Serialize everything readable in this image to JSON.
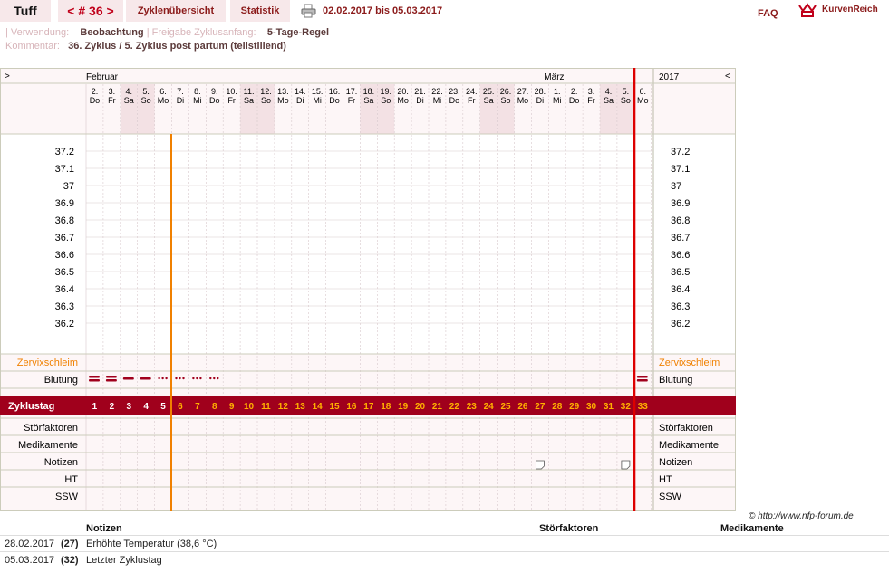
{
  "header": {
    "brand": "Tuff",
    "cycle_button": "< # 36 >",
    "overview_tab": "Zyklenübersicht",
    "stats_tab": "Statistik",
    "date_range": "02.02.2017 bis 05.03.2017",
    "faq": "FAQ",
    "logo_text": "KurvenReich",
    "printer_icon": "printer-icon",
    "logo_icon": "kurvenreich-logo-icon"
  },
  "meta": {
    "use_label": "Verwendung:",
    "use_value": "Beobachtung",
    "sep": "|",
    "release_label": "Freigabe Zyklusanfang:",
    "release_value": "5-Tage-Regel",
    "comment_label": "Kommentar:",
    "comment_value": "36. Zyklus / 5. Zyklus post partum (teilstillend)"
  },
  "chart": {
    "nav_left": ">",
    "nav_right": "<",
    "month1": "Februar",
    "month2": "März",
    "year": "2017",
    "days": [
      {
        "d": "2.",
        "w": "Do",
        "we": false
      },
      {
        "d": "3.",
        "w": "Fr",
        "we": false
      },
      {
        "d": "4.",
        "w": "Sa",
        "we": true
      },
      {
        "d": "5.",
        "w": "So",
        "we": true
      },
      {
        "d": "6.",
        "w": "Mo",
        "we": false
      },
      {
        "d": "7.",
        "w": "Di",
        "we": false
      },
      {
        "d": "8.",
        "w": "Mi",
        "we": false
      },
      {
        "d": "9.",
        "w": "Do",
        "we": false
      },
      {
        "d": "10.",
        "w": "Fr",
        "we": false
      },
      {
        "d": "11.",
        "w": "Sa",
        "we": true
      },
      {
        "d": "12.",
        "w": "So",
        "we": true
      },
      {
        "d": "13.",
        "w": "Mo",
        "we": false
      },
      {
        "d": "14.",
        "w": "Di",
        "we": false
      },
      {
        "d": "15.",
        "w": "Mi",
        "we": false
      },
      {
        "d": "16.",
        "w": "Do",
        "we": false
      },
      {
        "d": "17.",
        "w": "Fr",
        "we": false
      },
      {
        "d": "18.",
        "w": "Sa",
        "we": true
      },
      {
        "d": "19.",
        "w": "So",
        "we": true
      },
      {
        "d": "20.",
        "w": "Mo",
        "we": false
      },
      {
        "d": "21.",
        "w": "Di",
        "we": false
      },
      {
        "d": "22.",
        "w": "Mi",
        "we": false
      },
      {
        "d": "23.",
        "w": "Do",
        "we": false
      },
      {
        "d": "24.",
        "w": "Fr",
        "we": false
      },
      {
        "d": "25.",
        "w": "Sa",
        "we": true
      },
      {
        "d": "26.",
        "w": "So",
        "we": true
      },
      {
        "d": "27.",
        "w": "Mo",
        "we": false
      },
      {
        "d": "28.",
        "w": "Di",
        "we": false
      },
      {
        "d": "1.",
        "w": "Mi",
        "we": false
      },
      {
        "d": "2.",
        "w": "Do",
        "we": false
      },
      {
        "d": "3.",
        "w": "Fr",
        "we": false
      },
      {
        "d": "4.",
        "w": "Sa",
        "we": true
      },
      {
        "d": "5.",
        "w": "So",
        "we": true
      },
      {
        "d": "6.",
        "w": "Mo",
        "we": false
      }
    ],
    "temp_ticks": [
      "37.2",
      "37.1",
      "37",
      "36.9",
      "36.8",
      "36.7",
      "36.6",
      "36.5",
      "36.4",
      "36.3",
      "36.2"
    ],
    "cervix_label": "Zervixschleim",
    "bleeding_label": "Blutung",
    "cycleday_label": "Zyklustag",
    "cycle_days": [
      "1",
      "2",
      "3",
      "4",
      "5",
      "6",
      "7",
      "8",
      "9",
      "10",
      "11",
      "12",
      "13",
      "14",
      "15",
      "16",
      "17",
      "18",
      "19",
      "20",
      "21",
      "22",
      "23",
      "24",
      "25",
      "26",
      "27",
      "28",
      "29",
      "30",
      "31",
      "32",
      "33"
    ],
    "bleeding": [
      "heavy",
      "heavy",
      "medium",
      "medium",
      "light",
      "light",
      "light",
      "light",
      "",
      "",
      "",
      "",
      "",
      "",
      "",
      "",
      "",
      "",
      "",
      "",
      "",
      "",
      "",
      "",
      "",
      "",
      "",
      "",
      "",
      "",
      "",
      "",
      "heavy"
    ],
    "notes_days": [
      27,
      32
    ],
    "lower_rows": [
      "Störfaktoren",
      "Medikamente",
      "Notizen",
      "HT",
      "SSW"
    ],
    "colors": {
      "accent": "#a0001c",
      "orange": "#f08000",
      "weekend": "#f3e1e4",
      "grid": "#d8c9cc"
    }
  },
  "copyright": "© http://www.nfp-forum.de",
  "table": {
    "col_notes": "Notizen",
    "col_disturb": "Störfaktoren",
    "col_meds": "Medikamente",
    "rows": [
      {
        "date": "28.02.2017",
        "day": "(27)",
        "note": "Erhöhte Temperatur (38,6 °C)"
      },
      {
        "date": "05.03.2017",
        "day": "(32)",
        "note": "Letzter Zyklustag"
      }
    ]
  }
}
